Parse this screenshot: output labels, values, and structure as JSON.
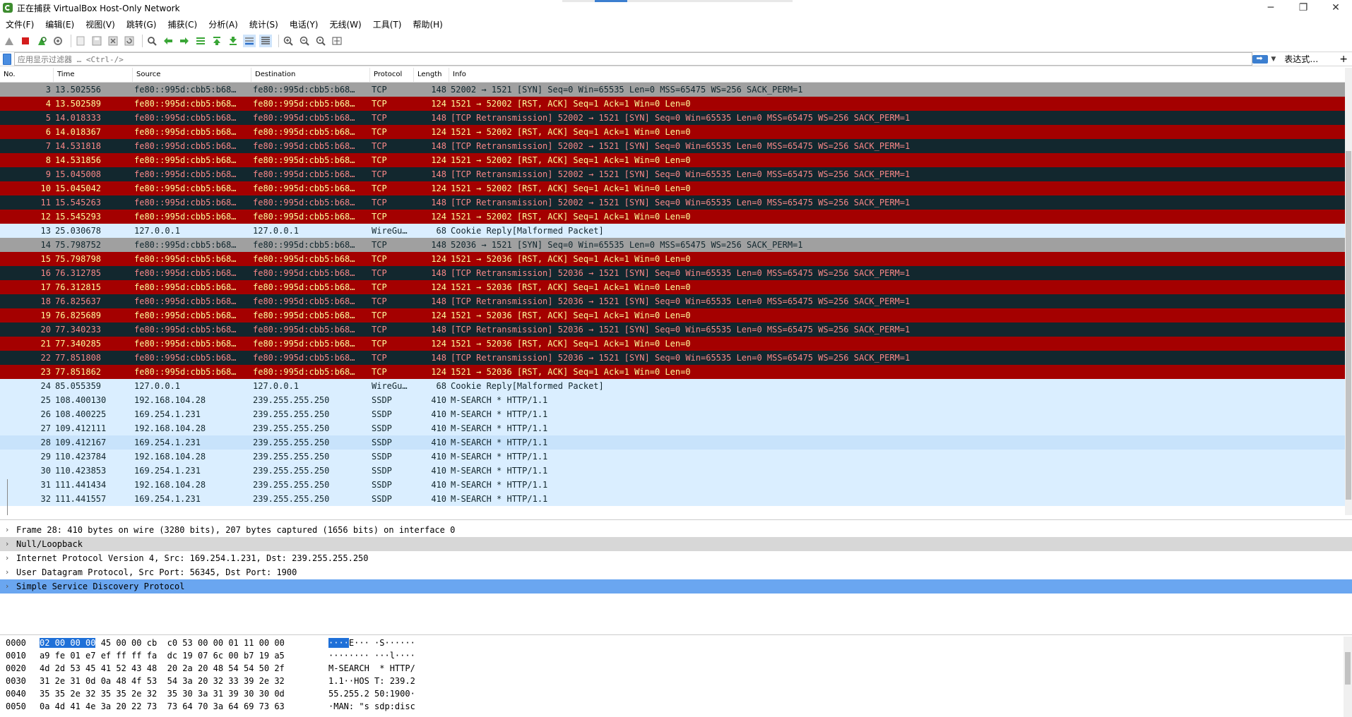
{
  "window": {
    "title": "正在捕获 VirtualBox Host-Only Network",
    "minimize": "─",
    "maximize": "❐",
    "close": "✕"
  },
  "menu": [
    "文件(F)",
    "编辑(E)",
    "视图(V)",
    "跳转(G)",
    "捕获(C)",
    "分析(A)",
    "统计(S)",
    "电话(Y)",
    "无线(W)",
    "工具(T)",
    "帮助(H)"
  ],
  "filter": {
    "placeholder": "应用显示过滤器 … <Ctrl-/>",
    "expression_label": "表达式…",
    "add_label": "+"
  },
  "columns": [
    "No.",
    "Time",
    "Source",
    "Destination",
    "Protocol",
    "Length",
    "Info"
  ],
  "packets": [
    {
      "no": "3",
      "time": "13.502556",
      "src": "fe80::995d:cbb5:b68…",
      "dst": "fe80::995d:cbb5:b68…",
      "proto": "TCP",
      "len": "148",
      "info": "52002 → 1521 [SYN] Seq=0 Win=65535 Len=0 MSS=65475 WS=256 SACK_PERM=1",
      "style": "gray"
    },
    {
      "no": "4",
      "time": "13.502589",
      "src": "fe80::995d:cbb5:b68…",
      "dst": "fe80::995d:cbb5:b68…",
      "proto": "TCP",
      "len": "124",
      "info": "1521 → 52002 [RST, ACK] Seq=1 Ack=1 Win=0 Len=0",
      "style": "red"
    },
    {
      "no": "5",
      "time": "14.018333",
      "src": "fe80::995d:cbb5:b68…",
      "dst": "fe80::995d:cbb5:b68…",
      "proto": "TCP",
      "len": "148",
      "info": "[TCP Retransmission] 52002 → 1521 [SYN] Seq=0 Win=65535 Len=0 MSS=65475 WS=256 SACK_PERM=1",
      "style": "dark"
    },
    {
      "no": "6",
      "time": "14.018367",
      "src": "fe80::995d:cbb5:b68…",
      "dst": "fe80::995d:cbb5:b68…",
      "proto": "TCP",
      "len": "124",
      "info": "1521 → 52002 [RST, ACK] Seq=1 Ack=1 Win=0 Len=0",
      "style": "red"
    },
    {
      "no": "7",
      "time": "14.531818",
      "src": "fe80::995d:cbb5:b68…",
      "dst": "fe80::995d:cbb5:b68…",
      "proto": "TCP",
      "len": "148",
      "info": "[TCP Retransmission] 52002 → 1521 [SYN] Seq=0 Win=65535 Len=0 MSS=65475 WS=256 SACK_PERM=1",
      "style": "dark"
    },
    {
      "no": "8",
      "time": "14.531856",
      "src": "fe80::995d:cbb5:b68…",
      "dst": "fe80::995d:cbb5:b68…",
      "proto": "TCP",
      "len": "124",
      "info": "1521 → 52002 [RST, ACK] Seq=1 Ack=1 Win=0 Len=0",
      "style": "red"
    },
    {
      "no": "9",
      "time": "15.045008",
      "src": "fe80::995d:cbb5:b68…",
      "dst": "fe80::995d:cbb5:b68…",
      "proto": "TCP",
      "len": "148",
      "info": "[TCP Retransmission] 52002 → 1521 [SYN] Seq=0 Win=65535 Len=0 MSS=65475 WS=256 SACK_PERM=1",
      "style": "dark"
    },
    {
      "no": "10",
      "time": "15.045042",
      "src": "fe80::995d:cbb5:b68…",
      "dst": "fe80::995d:cbb5:b68…",
      "proto": "TCP",
      "len": "124",
      "info": "1521 → 52002 [RST, ACK] Seq=1 Ack=1 Win=0 Len=0",
      "style": "red"
    },
    {
      "no": "11",
      "time": "15.545263",
      "src": "fe80::995d:cbb5:b68…",
      "dst": "fe80::995d:cbb5:b68…",
      "proto": "TCP",
      "len": "148",
      "info": "[TCP Retransmission] 52002 → 1521 [SYN] Seq=0 Win=65535 Len=0 MSS=65475 WS=256 SACK_PERM=1",
      "style": "dark"
    },
    {
      "no": "12",
      "time": "15.545293",
      "src": "fe80::995d:cbb5:b68…",
      "dst": "fe80::995d:cbb5:b68…",
      "proto": "TCP",
      "len": "124",
      "info": "1521 → 52002 [RST, ACK] Seq=1 Ack=1 Win=0 Len=0",
      "style": "red"
    },
    {
      "no": "13",
      "time": "25.030678",
      "src": "127.0.0.1",
      "dst": "127.0.0.1",
      "proto": "WireGu…",
      "len": "68",
      "info": "Cookie Reply[Malformed Packet]",
      "style": "light"
    },
    {
      "no": "14",
      "time": "75.798752",
      "src": "fe80::995d:cbb5:b68…",
      "dst": "fe80::995d:cbb5:b68…",
      "proto": "TCP",
      "len": "148",
      "info": "52036 → 1521 [SYN] Seq=0 Win=65535 Len=0 MSS=65475 WS=256 SACK_PERM=1",
      "style": "gray"
    },
    {
      "no": "15",
      "time": "75.798798",
      "src": "fe80::995d:cbb5:b68…",
      "dst": "fe80::995d:cbb5:b68…",
      "proto": "TCP",
      "len": "124",
      "info": "1521 → 52036 [RST, ACK] Seq=1 Ack=1 Win=0 Len=0",
      "style": "red"
    },
    {
      "no": "16",
      "time": "76.312785",
      "src": "fe80::995d:cbb5:b68…",
      "dst": "fe80::995d:cbb5:b68…",
      "proto": "TCP",
      "len": "148",
      "info": "[TCP Retransmission] 52036 → 1521 [SYN] Seq=0 Win=65535 Len=0 MSS=65475 WS=256 SACK_PERM=1",
      "style": "dark"
    },
    {
      "no": "17",
      "time": "76.312815",
      "src": "fe80::995d:cbb5:b68…",
      "dst": "fe80::995d:cbb5:b68…",
      "proto": "TCP",
      "len": "124",
      "info": "1521 → 52036 [RST, ACK] Seq=1 Ack=1 Win=0 Len=0",
      "style": "red"
    },
    {
      "no": "18",
      "time": "76.825637",
      "src": "fe80::995d:cbb5:b68…",
      "dst": "fe80::995d:cbb5:b68…",
      "proto": "TCP",
      "len": "148",
      "info": "[TCP Retransmission] 52036 → 1521 [SYN] Seq=0 Win=65535 Len=0 MSS=65475 WS=256 SACK_PERM=1",
      "style": "dark"
    },
    {
      "no": "19",
      "time": "76.825689",
      "src": "fe80::995d:cbb5:b68…",
      "dst": "fe80::995d:cbb5:b68…",
      "proto": "TCP",
      "len": "124",
      "info": "1521 → 52036 [RST, ACK] Seq=1 Ack=1 Win=0 Len=0",
      "style": "red"
    },
    {
      "no": "20",
      "time": "77.340233",
      "src": "fe80::995d:cbb5:b68…",
      "dst": "fe80::995d:cbb5:b68…",
      "proto": "TCP",
      "len": "148",
      "info": "[TCP Retransmission] 52036 → 1521 [SYN] Seq=0 Win=65535 Len=0 MSS=65475 WS=256 SACK_PERM=1",
      "style": "dark"
    },
    {
      "no": "21",
      "time": "77.340285",
      "src": "fe80::995d:cbb5:b68…",
      "dst": "fe80::995d:cbb5:b68…",
      "proto": "TCP",
      "len": "124",
      "info": "1521 → 52036 [RST, ACK] Seq=1 Ack=1 Win=0 Len=0",
      "style": "red"
    },
    {
      "no": "22",
      "time": "77.851808",
      "src": "fe80::995d:cbb5:b68…",
      "dst": "fe80::995d:cbb5:b68…",
      "proto": "TCP",
      "len": "148",
      "info": "[TCP Retransmission] 52036 → 1521 [SYN] Seq=0 Win=65535 Len=0 MSS=65475 WS=256 SACK_PERM=1",
      "style": "dark"
    },
    {
      "no": "23",
      "time": "77.851862",
      "src": "fe80::995d:cbb5:b68…",
      "dst": "fe80::995d:cbb5:b68…",
      "proto": "TCP",
      "len": "124",
      "info": "1521 → 52036 [RST, ACK] Seq=1 Ack=1 Win=0 Len=0",
      "style": "red"
    },
    {
      "no": "24",
      "time": "85.055359",
      "src": "127.0.0.1",
      "dst": "127.0.0.1",
      "proto": "WireGu…",
      "len": "68",
      "info": "Cookie Reply[Malformed Packet]",
      "style": "light"
    },
    {
      "no": "25",
      "time": "108.400130",
      "src": "192.168.104.28",
      "dst": "239.255.255.250",
      "proto": "SSDP",
      "len": "410",
      "info": "M-SEARCH * HTTP/1.1",
      "style": "light"
    },
    {
      "no": "26",
      "time": "108.400225",
      "src": "169.254.1.231",
      "dst": "239.255.255.250",
      "proto": "SSDP",
      "len": "410",
      "info": "M-SEARCH * HTTP/1.1",
      "style": "light"
    },
    {
      "no": "27",
      "time": "109.412111",
      "src": "192.168.104.28",
      "dst": "239.255.255.250",
      "proto": "SSDP",
      "len": "410",
      "info": "M-SEARCH * HTTP/1.1",
      "style": "light"
    },
    {
      "no": "28",
      "time": "109.412167",
      "src": "169.254.1.231",
      "dst": "239.255.255.250",
      "proto": "SSDP",
      "len": "410",
      "info": "M-SEARCH * HTTP/1.1",
      "style": "sel"
    },
    {
      "no": "29",
      "time": "110.423784",
      "src": "192.168.104.28",
      "dst": "239.255.255.250",
      "proto": "SSDP",
      "len": "410",
      "info": "M-SEARCH * HTTP/1.1",
      "style": "light"
    },
    {
      "no": "30",
      "time": "110.423853",
      "src": "169.254.1.231",
      "dst": "239.255.255.250",
      "proto": "SSDP",
      "len": "410",
      "info": "M-SEARCH * HTTP/1.1",
      "style": "light"
    },
    {
      "no": "31",
      "time": "111.441434",
      "src": "192.168.104.28",
      "dst": "239.255.255.250",
      "proto": "SSDP",
      "len": "410",
      "info": "M-SEARCH * HTTP/1.1",
      "style": "light"
    },
    {
      "no": "32",
      "time": "111.441557",
      "src": "169.254.1.231",
      "dst": "239.255.255.250",
      "proto": "SSDP",
      "len": "410",
      "info": "M-SEARCH * HTTP/1.1",
      "style": "light"
    }
  ],
  "details": [
    {
      "text": "Frame 28: 410 bytes on wire (3280 bits), 207 bytes captured (1656 bits) on interface 0",
      "hl": ""
    },
    {
      "text": "Null/Loopback",
      "hl": "gray"
    },
    {
      "text": "Internet Protocol Version 4, Src: 169.254.1.231, Dst: 239.255.255.250",
      "hl": ""
    },
    {
      "text": "User Datagram Protocol, Src Port: 56345, Dst Port: 1900",
      "hl": ""
    },
    {
      "text": "Simple Service Discovery Protocol",
      "hl": "blue"
    }
  ],
  "bytes": [
    {
      "off": "0000",
      "hex_sel": "02 00 00 00",
      "hex_rest": " 45 00 00 cb  c0 53 00 00 01 11 00 00",
      "ascii_sel": "····",
      "ascii_rest": "E··· ·S······"
    },
    {
      "off": "0010",
      "hex_sel": "",
      "hex_rest": "a9 fe 01 e7 ef ff ff fa  dc 19 07 6c 00 b7 19 a5",
      "ascii_sel": "",
      "ascii_rest": "········ ···l····"
    },
    {
      "off": "0020",
      "hex_sel": "",
      "hex_rest": "4d 2d 53 45 41 52 43 48  20 2a 20 48 54 54 50 2f",
      "ascii_sel": "",
      "ascii_rest": "M-SEARCH  * HTTP/"
    },
    {
      "off": "0030",
      "hex_sel": "",
      "hex_rest": "31 2e 31 0d 0a 48 4f 53  54 3a 20 32 33 39 2e 32",
      "ascii_sel": "",
      "ascii_rest": "1.1··HOS T: 239.2"
    },
    {
      "off": "0040",
      "hex_sel": "",
      "hex_rest": "35 35 2e 32 35 35 2e 32  35 30 3a 31 39 30 30 0d",
      "ascii_sel": "",
      "ascii_rest": "55.255.2 50:1900·"
    },
    {
      "off": "0050",
      "hex_sel": "",
      "hex_rest": "0a 4d 41 4e 3a 20 22 73  73 64 70 3a 64 69 73 63",
      "ascii_sel": "",
      "ascii_rest": "·MAN: \"s sdp:disc"
    }
  ],
  "colors": {
    "row_gray": "#a0a0a0",
    "row_red": "#a40000",
    "row_dark": "#12272e",
    "row_light": "#daeeff",
    "row_selected": "#c8e3fb",
    "detail_highlight": "#6aa6f0"
  }
}
